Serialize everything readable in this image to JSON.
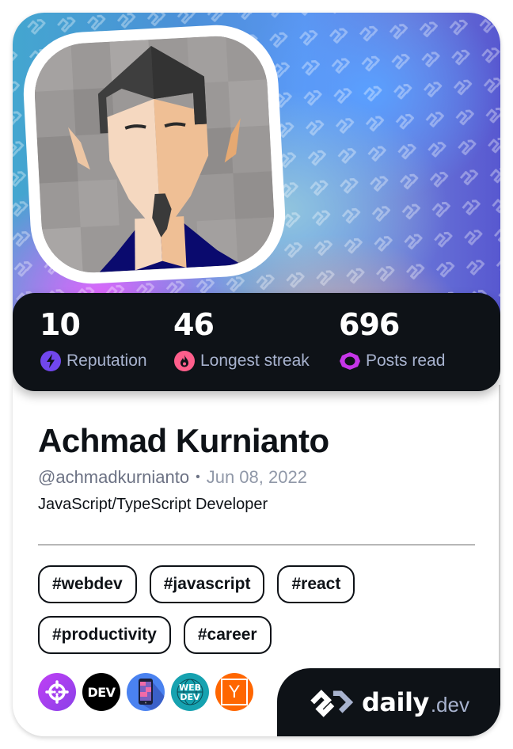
{
  "profile": {
    "name": "Achmad Kurnianto",
    "handle": "@achmadkurnianto",
    "separator": "•",
    "joined": "Jun 08, 2022",
    "bio": "JavaScript/TypeScript Developer"
  },
  "stats": [
    {
      "value": "10",
      "label": "Reputation",
      "icon": "reputation-bolt-icon",
      "color": "#7147ed"
    },
    {
      "value": "46",
      "label": "Longest streak",
      "icon": "streak-flame-icon",
      "color": "#ff5e8b"
    },
    {
      "value": "696",
      "label": "Posts read",
      "icon": "posts-read-ring-icon",
      "color": "#c635e8"
    }
  ],
  "tags": [
    "#webdev",
    "#javascript",
    "#react",
    "#productivity",
    "#career"
  ],
  "sources": [
    {
      "name": "crosshair-source",
      "color": "#b044f0"
    },
    {
      "name": "dev-to",
      "label": "DEV",
      "color": "#000000"
    },
    {
      "name": "mobile-source",
      "color": "#4a82f0"
    },
    {
      "name": "web-dev",
      "label_top": "WEB",
      "label_bottom": "DEV",
      "color": "#16a2b0"
    },
    {
      "name": "hacker-news",
      "label": "Y",
      "color": "#ff6600"
    }
  ],
  "brand": {
    "word": "daily",
    "tld": ".dev"
  }
}
